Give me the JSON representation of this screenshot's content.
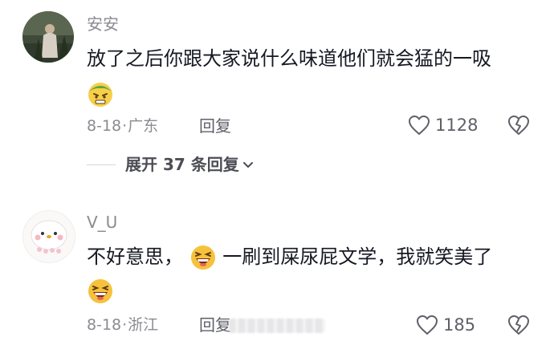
{
  "comments": [
    {
      "username": "安安",
      "text": "放了之后你跟大家说什么味道他们就会猛的一吸",
      "emoji": "grimace-emoji",
      "date": "8-18",
      "location": "广东",
      "reply_label": "回复",
      "likes": "1128"
    },
    {
      "username": "V_U",
      "text_part1": "不好意思，",
      "text_part2": "一刷到屎尿屁文学，我就笑美了",
      "emoji_inline": "laughing-emoji",
      "emoji_trailing": "laughing-emoji",
      "date": "8-18",
      "location": "浙江",
      "reply_label": "回复",
      "likes": "185"
    }
  ],
  "expand_replies": {
    "label": "展开 37 条回复"
  },
  "meta_separator": "·",
  "colors": {
    "text": "#161823",
    "secondary": "#8a8b91",
    "background": "#ffffff"
  }
}
